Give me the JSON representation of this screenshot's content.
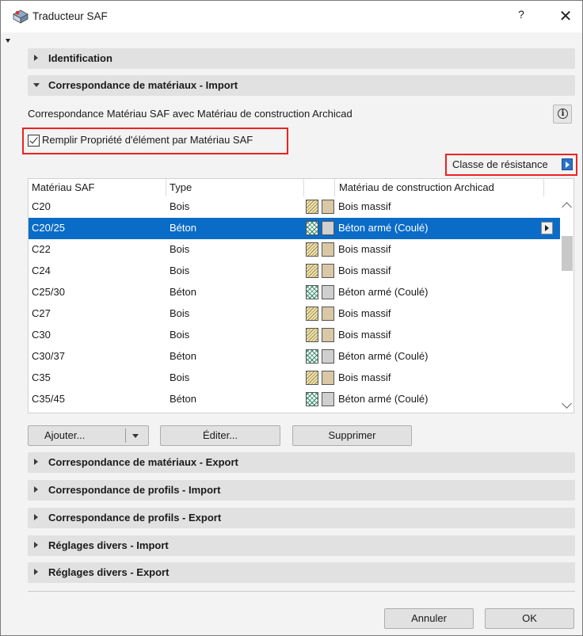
{
  "window": {
    "title": "Traducteur SAF",
    "help": "?",
    "close": "✕"
  },
  "sections": [
    {
      "label": "Identification",
      "expanded": false
    },
    {
      "label": "Correspondance de matériaux - Import",
      "expanded": true
    },
    {
      "label": "Correspondance de matériaux - Export",
      "expanded": false
    },
    {
      "label": "Correspondance de profils - Import",
      "expanded": false
    },
    {
      "label": "Correspondance de profils - Export",
      "expanded": false
    },
    {
      "label": "Réglages divers - Import",
      "expanded": false
    },
    {
      "label": "Réglages divers - Export",
      "expanded": false
    }
  ],
  "import_panel": {
    "description": "Correspondance Matériau SAF avec Matériau de construction Archicad",
    "info_icon": "info-icon",
    "checkbox_label": "Remplir Propriété d'élément par Matériau SAF",
    "checkbox_checked": true,
    "resistance_label": "Classe de résistance",
    "highlight_color": "#e22222",
    "selection_color": "#0a6cc7"
  },
  "table": {
    "headers": [
      "Matériau SAF",
      "Type",
      "Matériau de construction Archicad"
    ],
    "rows": [
      {
        "saf": "C20",
        "type": "Bois",
        "material": "Bois massif",
        "swatch": "wood"
      },
      {
        "saf": "C20/25",
        "type": "Béton",
        "material": "Béton armé (Coulé)",
        "swatch": "concrete",
        "selected": true
      },
      {
        "saf": "C22",
        "type": "Bois",
        "material": "Bois massif",
        "swatch": "wood"
      },
      {
        "saf": "C24",
        "type": "Bois",
        "material": "Bois massif",
        "swatch": "wood"
      },
      {
        "saf": "C25/30",
        "type": "Béton",
        "material": "Béton armé (Coulé)",
        "swatch": "concrete"
      },
      {
        "saf": "C27",
        "type": "Bois",
        "material": "Bois massif",
        "swatch": "wood"
      },
      {
        "saf": "C30",
        "type": "Bois",
        "material": "Bois massif",
        "swatch": "wood"
      },
      {
        "saf": "C30/37",
        "type": "Béton",
        "material": "Béton armé (Coulé)",
        "swatch": "concrete"
      },
      {
        "saf": "C35",
        "type": "Bois",
        "material": "Bois massif",
        "swatch": "wood"
      },
      {
        "saf": "C35/45",
        "type": "Béton",
        "material": "Béton armé (Coulé)",
        "swatch": "concrete"
      }
    ]
  },
  "buttons": {
    "add": "Ajouter...",
    "edit": "Éditer...",
    "delete": "Supprimer",
    "cancel": "Annuler",
    "ok": "OK"
  }
}
